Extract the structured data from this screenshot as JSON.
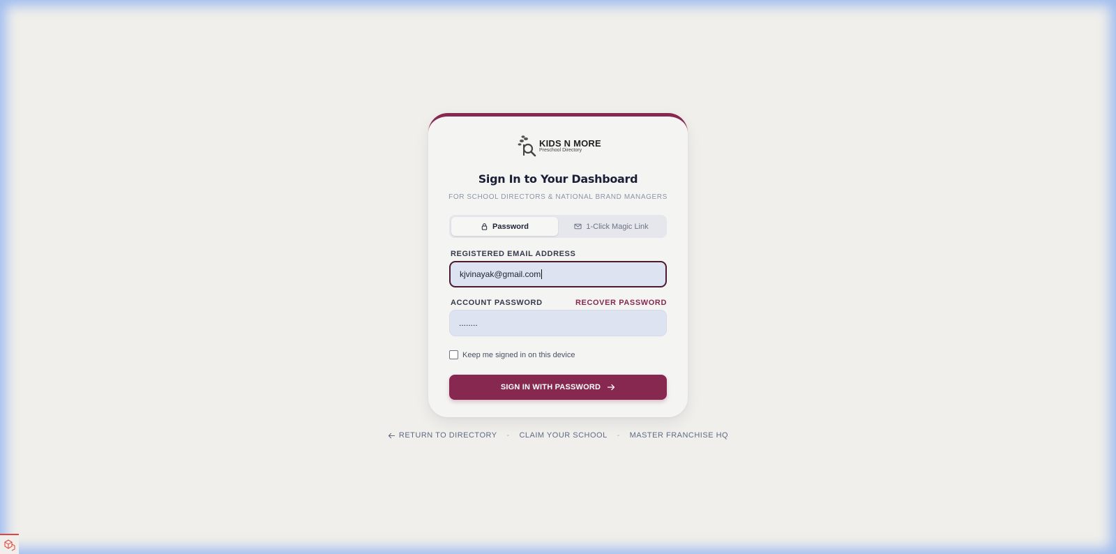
{
  "logo": {
    "name": "KIDS N MORE",
    "tagline": "Preschool Directory"
  },
  "header": {
    "title": "Sign In to Your Dashboard",
    "subtitle": "FOR SCHOOL DIRECTORS & NATIONAL BRAND MANAGERS"
  },
  "tabs": [
    {
      "label": "Password",
      "icon": "lock-icon",
      "active": true
    },
    {
      "label": "1-Click Magic Link",
      "icon": "mail-icon",
      "active": false
    }
  ],
  "form": {
    "email_label": "REGISTERED EMAIL ADDRESS",
    "email_value": "kjvinayak@gmail.com",
    "password_label": "ACCOUNT PASSWORD",
    "recover_link": "RECOVER PASSWORD",
    "password_value": "........",
    "remember_label": "Keep me signed in on this device",
    "remember_checked": false,
    "submit_label": "SIGN IN WITH PASSWORD"
  },
  "footer": {
    "return_link": "RETURN TO DIRECTORY",
    "claim_link": "CLAIM YOUR SCHOOL",
    "hq_link": "MASTER FRANCHISE HQ",
    "separator": "-"
  },
  "colors": {
    "brand": "#86284f",
    "background": "#f0efeb",
    "input_bg": "#dde3f1"
  }
}
